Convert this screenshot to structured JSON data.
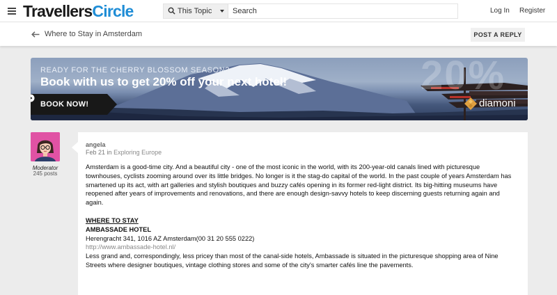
{
  "header": {
    "logo_part1": "Travellers",
    "logo_part2": "Circle",
    "search_scope": "This Topic",
    "search_placeholder": "Search",
    "login_label": "Log In",
    "register_label": "Register",
    "logo_colors": {
      "primary": "#1a1a1a",
      "accent": "#1f8dd6"
    }
  },
  "topic_bar": {
    "title": "Where to Stay in Amsterdam",
    "reply_label": "POST A REPLY"
  },
  "banner": {
    "kicker": "READY FOR THE CHERRY BLOSSOM SEASON?",
    "headline": "Book with us to get 20% off your next hotel!",
    "cta_label": "BOOK NOW!",
    "percent_text": "20%",
    "brand_name": "diamoni",
    "brand_color": "#f0a830"
  },
  "post": {
    "author": "angela",
    "role": "Moderator",
    "post_count": "245 posts",
    "date": "Feb 21",
    "in_label": "in",
    "category": "Exploring Europe",
    "paragraph1": "Amsterdam is a good-time city. And a beautiful city - one of the most iconic in the world, with its 200-year-old canals lined with picturesque townhouses, cyclists zooming around over its little bridges. No longer is it the stag-do capital of the world. In the past couple of years Amsterdam has smartened up its act, with art galleries and stylish boutiques and buzzy cafés opening in its former red-light district. Its big-hitting museums have reopened after years of improvements and renovations, and there are enough design-savvy hotels to keep discerning guests returning again and again.",
    "section_heading": "WHERE TO STAY",
    "hotel_name": "AMBASSADE HOTEL",
    "hotel_address": "Herengracht 341, 1016 AZ Amsterdam(00 31 20 555 0222)",
    "hotel_url": "http://www.ambassade-hotel.nl/",
    "hotel_description": "Less grand and, correspondingly, less pricey than most of the canal-side hotels, Ambassade is situated in the picturesque shopping area of Nine Streets where designer boutiques, vintage clothing stores and some of the city's smarter cafés line the pavements."
  },
  "icons": {
    "menu": "hamburger-icon",
    "search": "search-icon",
    "back": "back-arrow-icon",
    "cta": "play-circle-icon",
    "avatar": "user-avatar"
  }
}
